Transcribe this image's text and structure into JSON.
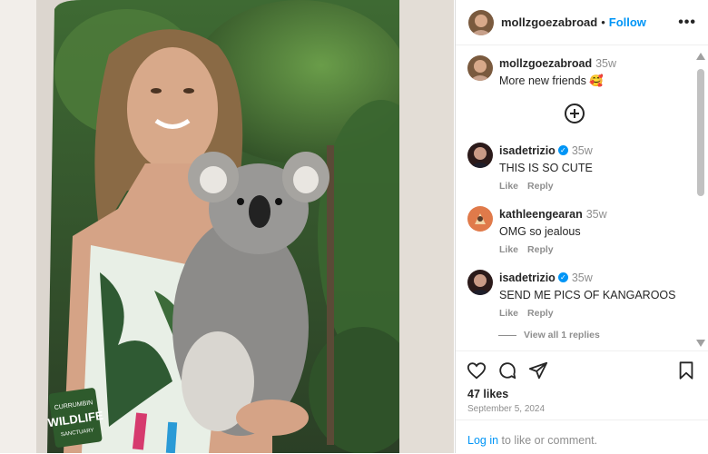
{
  "post": {
    "image_alt": "Woman holding a koala in front of green foliage",
    "sign_text": [
      "CURRUMBIN",
      "WILDLIFE",
      "SANCTUARY"
    ]
  },
  "header": {
    "username": "mollzgoezabroad",
    "separator": "•",
    "follow_label": "Follow",
    "more_label": "•••"
  },
  "caption": {
    "username": "mollzgoezabroad",
    "time": "35w",
    "text": "More new friends 🥰"
  },
  "comments": [
    {
      "username": "isadetrizio",
      "verified": true,
      "time": "35w",
      "text": "THIS IS SO CUTE",
      "like_label": "Like",
      "reply_label": "Reply"
    },
    {
      "username": "kathleengearan",
      "verified": false,
      "time": "35w",
      "text": "OMG so jealous",
      "like_label": "Like",
      "reply_label": "Reply"
    },
    {
      "username": "isadetrizio",
      "verified": true,
      "time": "35w",
      "text": "SEND ME PICS OF KANGAROOS",
      "like_label": "Like",
      "reply_label": "Reply"
    }
  ],
  "view_replies_label": "View all 1 replies",
  "actions": {
    "likes": "47 likes",
    "date": "September 5, 2024"
  },
  "login": {
    "link": "Log in",
    "suffix": " to like or comment."
  },
  "colors": {
    "accent": "#0095f6",
    "muted": "#8e8e8e",
    "text": "#262626"
  }
}
